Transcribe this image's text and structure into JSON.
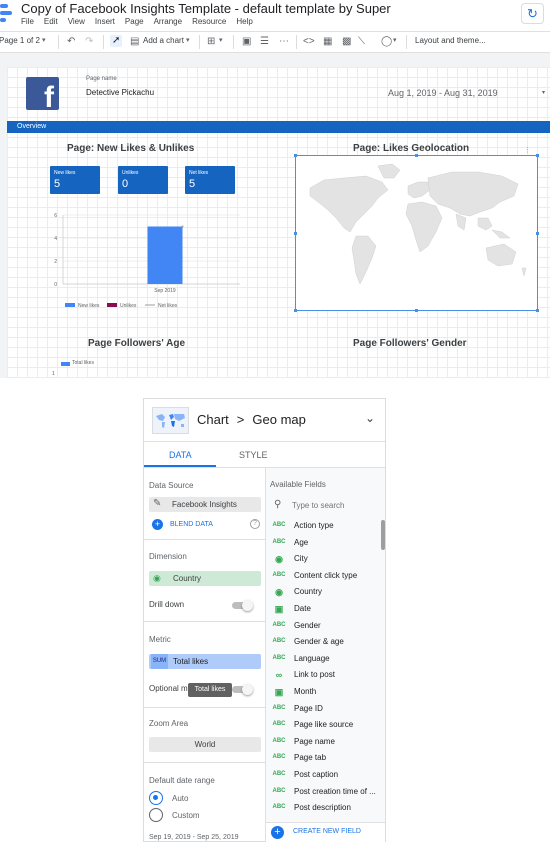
{
  "header": {
    "title": "Copy of Facebook Insights Template - default template by Super",
    "menu": [
      "File",
      "Edit",
      "View",
      "Insert",
      "Page",
      "Arrange",
      "Resource",
      "Help"
    ],
    "brand_color": "#4285f4"
  },
  "toolbar": {
    "page_indicator": "Page 1 of 2",
    "add_chart": "Add a chart",
    "layout_theme": "Layout and theme..."
  },
  "report": {
    "page_name_label": "Page name",
    "page_name": "Detective Pickachu",
    "date_range": "Aug 1, 2019 - Aug 31, 2019",
    "overview": "Overview",
    "accent_color": "#1565c0",
    "sections": {
      "likes": "Page: New Likes & Unlikes",
      "geo": "Page: Likes Geolocation",
      "age": "Page Followers' Age",
      "gender": "Page Followers' Gender"
    },
    "kpis": [
      {
        "label": "New likes",
        "value": "5"
      },
      {
        "label": "Unlikes",
        "value": "0"
      },
      {
        "label": "Net likes",
        "value": "5"
      }
    ],
    "age_legend": "Total likes",
    "age_tick": "1"
  },
  "chart_data": {
    "type": "bar",
    "categories": [
      "Sep 2019"
    ],
    "series": [
      {
        "name": "New likes",
        "values": [
          5
        ],
        "color": "#4285f4"
      },
      {
        "name": "Unlikes",
        "values": [
          0
        ],
        "color": "#880e4f"
      },
      {
        "name": "Net likes",
        "values": [
          5
        ],
        "color": "#9e9e9e"
      }
    ],
    "yticks": [
      "0",
      "2",
      "4",
      "6"
    ],
    "ylim": [
      0,
      6
    ],
    "legend_position": "bottom"
  },
  "panel": {
    "breadcrumb_root": "Chart",
    "breadcrumb_sep": ">",
    "chart_type": "Geo map",
    "tabs": [
      "DATA",
      "STYLE"
    ],
    "data_source_label": "Data Source",
    "data_source": "Facebook Insights",
    "blend_data": "BLEND DATA",
    "dimension_label": "Dimension",
    "dimension": "Country",
    "drill_down": "Drill down",
    "metric_label": "Metric",
    "metric_agg": "SUM",
    "metric": "Total likes",
    "optional_metrics": "Optional m",
    "tooltip": "Total likes",
    "zoom_label": "Zoom Area",
    "zoom": "World",
    "date_range_label": "Default date range",
    "auto": "Auto",
    "custom": "Custom",
    "date_note": "Sep 19, 2019 - Sep 25, 2019",
    "available_fields": "Available Fields",
    "search_placeholder": "Type to search",
    "fields": [
      {
        "name": "Action type",
        "icon": "text"
      },
      {
        "name": "Age",
        "icon": "text"
      },
      {
        "name": "City",
        "icon": "geo"
      },
      {
        "name": "Content click type",
        "icon": "text"
      },
      {
        "name": "Country",
        "icon": "geo"
      },
      {
        "name": "Date",
        "icon": "date"
      },
      {
        "name": "Gender",
        "icon": "text"
      },
      {
        "name": "Gender & age",
        "icon": "text"
      },
      {
        "name": "Language",
        "icon": "text"
      },
      {
        "name": "Link to post",
        "icon": "link"
      },
      {
        "name": "Month",
        "icon": "date"
      },
      {
        "name": "Page ID",
        "icon": "text"
      },
      {
        "name": "Page like source",
        "icon": "text"
      },
      {
        "name": "Page name",
        "icon": "text"
      },
      {
        "name": "Page tab",
        "icon": "text"
      },
      {
        "name": "Post caption",
        "icon": "text"
      },
      {
        "name": "Post creation time of ...",
        "icon": "text"
      },
      {
        "name": "Post description",
        "icon": "text"
      }
    ],
    "field_type_text": "ABC",
    "create_field": "CREATE NEW FIELD"
  }
}
